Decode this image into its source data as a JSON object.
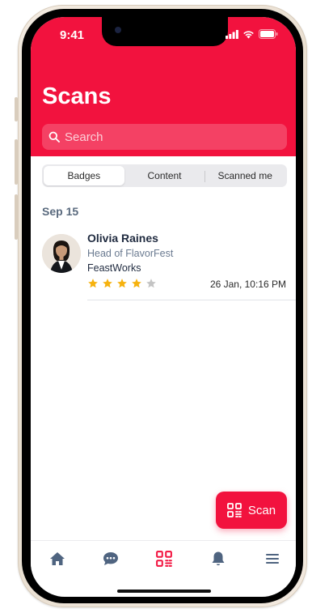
{
  "status_bar": {
    "time": "9:41"
  },
  "header": {
    "title": "Scans"
  },
  "search": {
    "placeholder": "Search"
  },
  "tabs": [
    {
      "label": "Badges",
      "active": true
    },
    {
      "label": "Content",
      "active": false
    },
    {
      "label": "Scanned me",
      "active": false
    }
  ],
  "sections": [
    {
      "date": "Sep 15",
      "items": [
        {
          "name": "Olivia Raines",
          "role": "Head of FlavorFest",
          "company": "FeastWorks",
          "rating": 4,
          "rating_max": 5,
          "timestamp": "26 Jan, 10:16 PM"
        }
      ]
    }
  ],
  "fab": {
    "label": "Scan",
    "icon": "qr-code-icon"
  },
  "bottom_nav": [
    {
      "icon": "home-icon",
      "active": false
    },
    {
      "icon": "chat-icon",
      "active": false
    },
    {
      "icon": "qr-code-icon",
      "active": true
    },
    {
      "icon": "bell-icon",
      "active": false
    },
    {
      "icon": "menu-icon",
      "active": false
    }
  ],
  "colors": {
    "brand": "#f2123e",
    "nav_inactive": "#4f6480",
    "star_filled": "#f6b20e",
    "star_empty": "#c4c4c4"
  }
}
